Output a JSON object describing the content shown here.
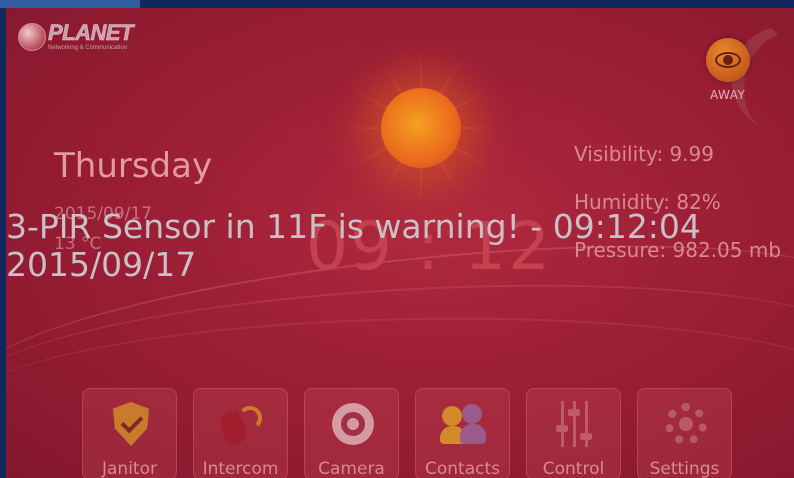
{
  "brand": {
    "name": "PLANET",
    "tagline": "Networking & Communication"
  },
  "mode": {
    "label": "AWAY",
    "icon": "eye-icon",
    "color": "#d8792a"
  },
  "datetime": {
    "day": "Thursday",
    "date": "2015/09/17",
    "temperature": "13 °C",
    "time": "09 : 12"
  },
  "weather": {
    "visibility": "Visibility: 9.99",
    "humidity": "Humidity: 82%",
    "pressure": "Pressure: 982.05 mb"
  },
  "alert": {
    "line1": "3-PIR Sensor in 11F is warning! - 09:12:04",
    "line2": "2015/09/17",
    "color": "#c9c0c8"
  },
  "dock": [
    {
      "label": "Janitor",
      "icon": "shield-check-icon"
    },
    {
      "label": "Intercom",
      "icon": "phone-icon"
    },
    {
      "label": "Camera",
      "icon": "camera-icon"
    },
    {
      "label": "Contacts",
      "icon": "contacts-icon"
    },
    {
      "label": "Control",
      "icon": "sliders-icon"
    },
    {
      "label": "Settings",
      "icon": "gear-icon"
    }
  ],
  "colors": {
    "background": "#9c1f35",
    "frame": "#10285e",
    "accent": "#2f5da0"
  }
}
